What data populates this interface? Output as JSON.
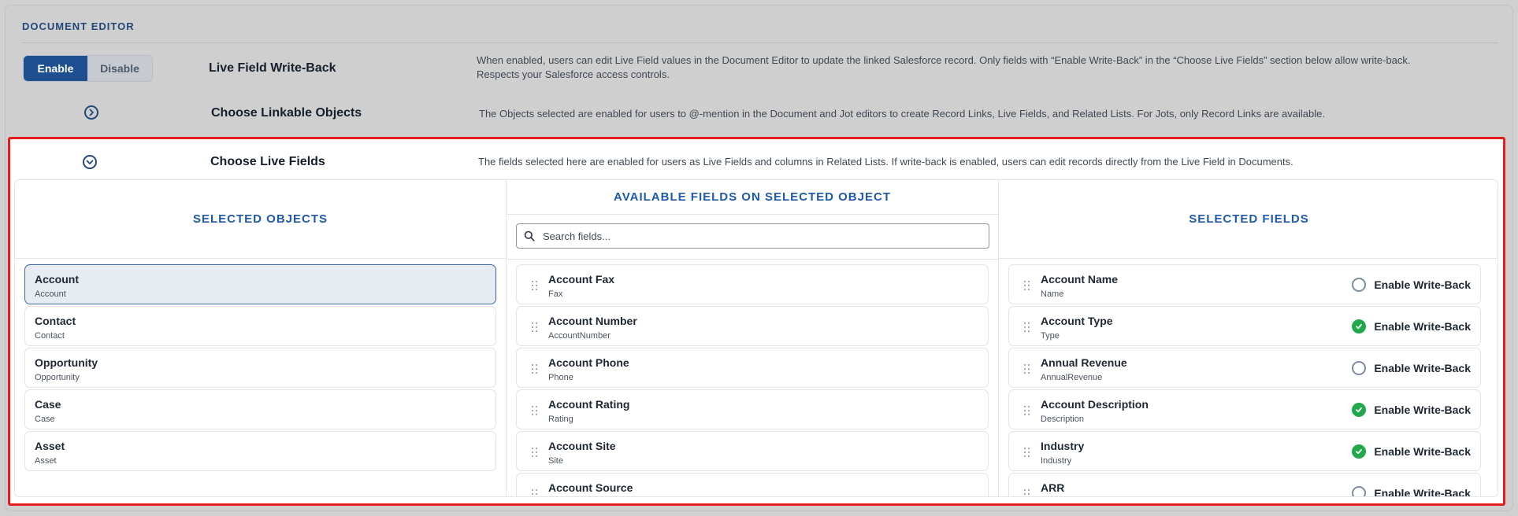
{
  "section_title": "DOCUMENT EDITOR",
  "toggle": {
    "enable": "Enable",
    "disable": "Disable",
    "selected": "Enable"
  },
  "rows": {
    "write_back": {
      "label": "Live Field Write-Back",
      "desc1": "When enabled, users can edit Live Field values in the Document Editor to update the linked Salesforce record. Only fields with “Enable Write-Back” in the “Choose Live Fields” section below allow write-back.",
      "desc2": "Respects your Salesforce access controls."
    },
    "linkable": {
      "label": "Choose Linkable Objects",
      "desc": "The Objects selected are enabled for users to @-mention in the Document and Jot editors to create Record Links, Live Fields, and Related Lists. For Jots, only Record Links are available."
    },
    "live_fields": {
      "label": "Choose Live Fields",
      "desc": "The fields selected here are enabled for users as Live Fields and columns in Related Lists. If write-back is enabled, users can edit records directly from the Live Field in Documents."
    }
  },
  "columns": {
    "selected_objects": "SELECTED OBJECTS",
    "available_fields": "AVAILABLE FIELDS ON SELECTED OBJECT",
    "selected_fields": "SELECTED FIELDS"
  },
  "search": {
    "placeholder": "Search fields..."
  },
  "objects": [
    {
      "title": "Account",
      "sub": "Account"
    },
    {
      "title": "Contact",
      "sub": "Contact"
    },
    {
      "title": "Opportunity",
      "sub": "Opportunity"
    },
    {
      "title": "Case",
      "sub": "Case"
    },
    {
      "title": "Asset",
      "sub": "Asset"
    }
  ],
  "available_fields": [
    {
      "title": "Account Fax",
      "sub": "Fax"
    },
    {
      "title": "Account Number",
      "sub": "AccountNumber"
    },
    {
      "title": "Account Phone",
      "sub": "Phone"
    },
    {
      "title": "Account Rating",
      "sub": "Rating"
    },
    {
      "title": "Account Site",
      "sub": "Site"
    },
    {
      "title": "Account Source",
      "sub": ""
    }
  ],
  "selected_fields": [
    {
      "title": "Account Name",
      "sub": "Name",
      "write_back": false
    },
    {
      "title": "Account Type",
      "sub": "Type",
      "write_back": true
    },
    {
      "title": "Annual Revenue",
      "sub": "AnnualRevenue",
      "write_back": false
    },
    {
      "title": "Account Description",
      "sub": "Description",
      "write_back": true
    },
    {
      "title": "Industry",
      "sub": "Industry",
      "write_back": true
    },
    {
      "title": "ARR",
      "sub": "",
      "write_back": false
    }
  ],
  "write_back_label": "Enable Write-Back",
  "colors": {
    "accent": "#1d4f91",
    "highlight": "#e51c1c",
    "check": "#21a84a"
  }
}
